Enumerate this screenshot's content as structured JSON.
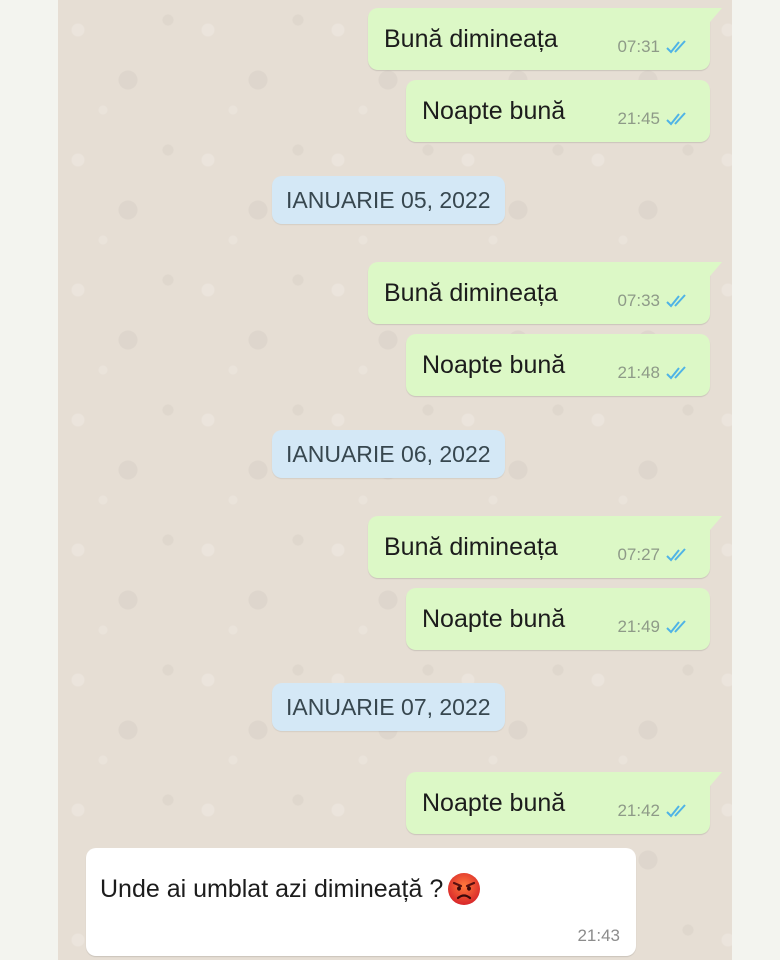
{
  "messages": [
    {
      "text": "Bună dimineața",
      "time": "07:31",
      "status_icon": "double-check-icon"
    },
    {
      "text": "Noapte bună",
      "time": "21:45",
      "status_icon": "double-check-icon"
    },
    {
      "text": "Bună dimineața",
      "time": "07:33",
      "status_icon": "double-check-icon"
    },
    {
      "text": "Noapte bună",
      "time": "21:48",
      "status_icon": "double-check-icon"
    },
    {
      "text": "Bună dimineața",
      "time": "07:27",
      "status_icon": "double-check-icon"
    },
    {
      "text": "Noapte bună",
      "time": "21:49",
      "status_icon": "double-check-icon"
    },
    {
      "text": "Noapte bună",
      "time": "21:42",
      "status_icon": "double-check-icon"
    }
  ],
  "date_separators": [
    "IANUARIE 05, 2022",
    "IANUARIE 06, 2022",
    "IANUARIE 07, 2022"
  ],
  "incoming": {
    "text": "Unde ai umblat azi dimineață ?",
    "emoji": "angry-face-icon",
    "time": "21:43"
  },
  "colors": {
    "outgoing_bubble": "#dcf8c6",
    "incoming_bubble": "#ffffff",
    "date_chip": "#d4e8f6",
    "chat_background": "#e6ded4",
    "read_ticks": "#4fb3e6"
  }
}
